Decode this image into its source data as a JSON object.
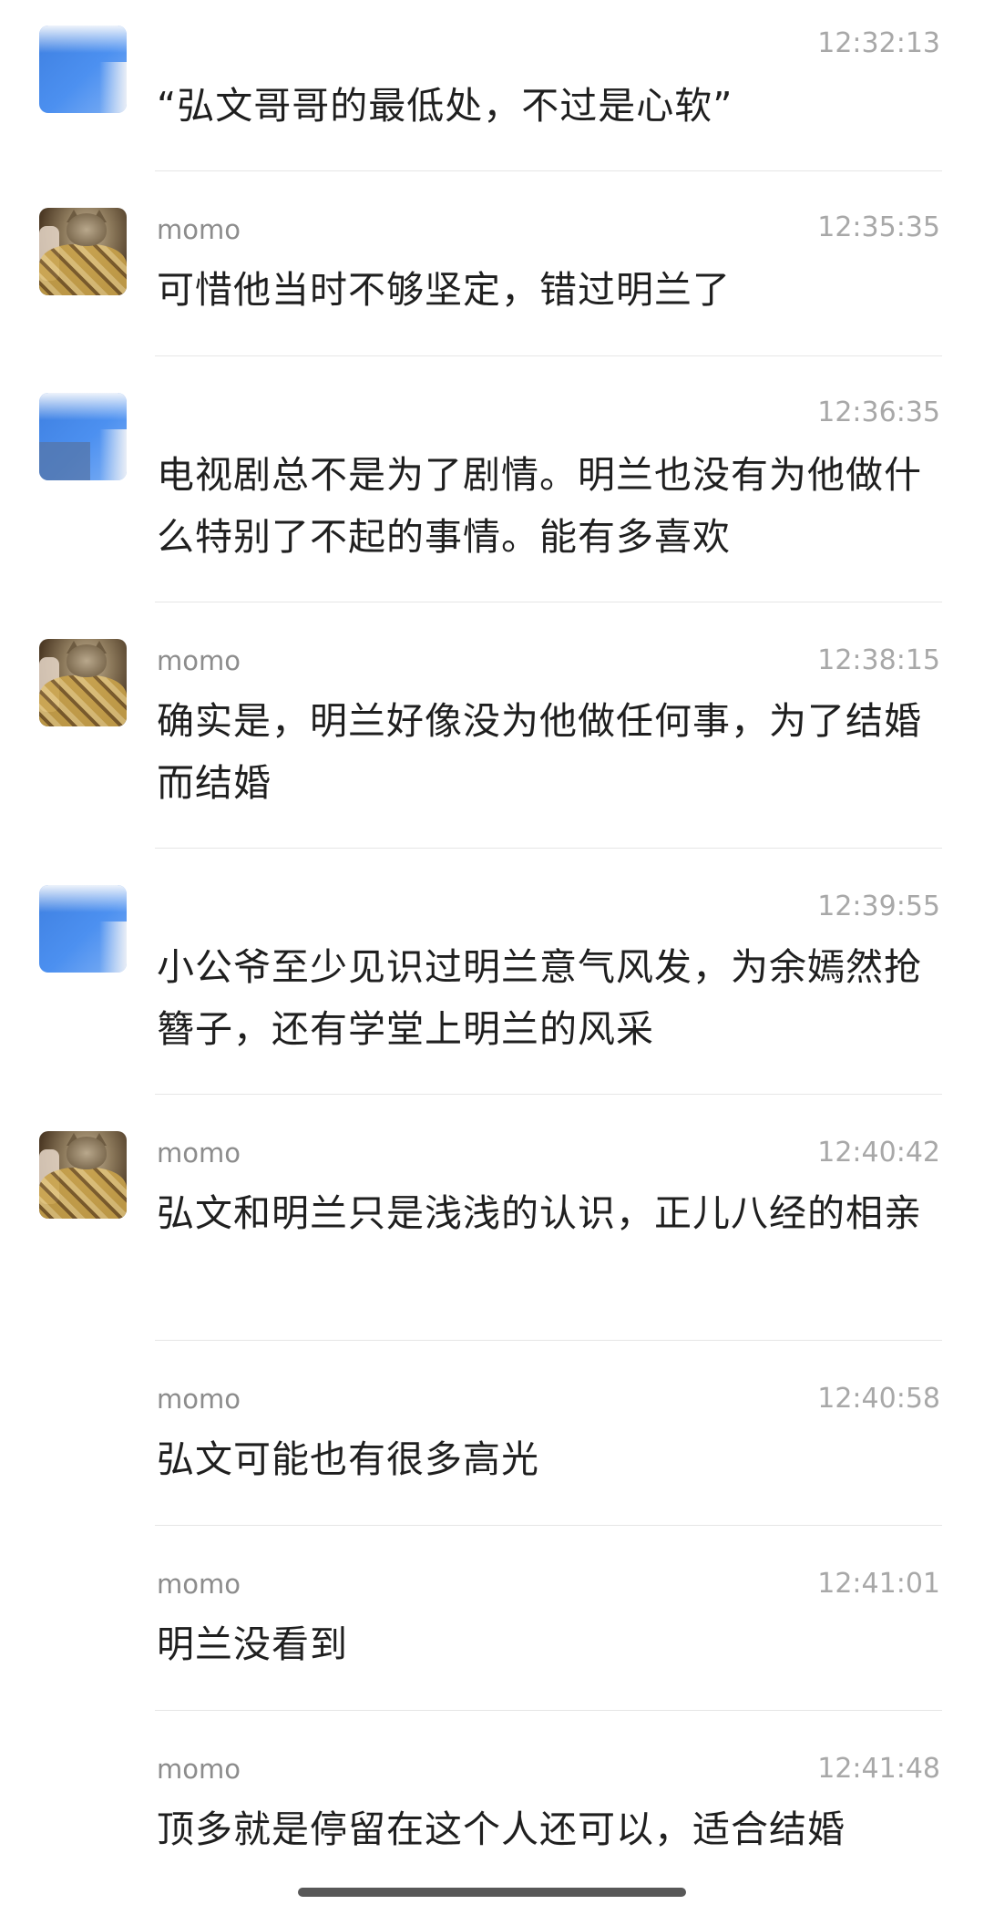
{
  "messages": [
    {
      "sender": "",
      "time": "12:32:13",
      "text": "“弘文哥哥的最低处，不过是心软”",
      "avatar": "blurred-avatar"
    },
    {
      "sender": "momo",
      "time": "12:35:35",
      "text": "可惜他当时不够坚定，错过明兰了",
      "avatar": "cat-avatar"
    },
    {
      "sender": "",
      "time": "12:36:35",
      "text": "电视剧总不是为了剧情。明兰也没有为他做什么特别了不起的事情。能有多喜欢",
      "avatar": "blurred-avatar"
    },
    {
      "sender": "momo",
      "time": "12:38:15",
      "text": "确实是，明兰好像没为他做任何事，为了结婚而结婚",
      "avatar": "cat-avatar"
    },
    {
      "sender": "",
      "time": "12:39:55",
      "text": "小公爷至少见识过明兰意气风发，为余嫣然抢簪子，还有学堂上明兰的风采",
      "avatar": "blurred-avatar"
    },
    {
      "sender": "momo",
      "time": "12:40:42",
      "text": "弘文和明兰只是浅浅的认识，正儿八经的相亲",
      "avatar": "cat-avatar"
    },
    {
      "sender": "momo",
      "time": "12:40:58",
      "text": "弘文可能也有很多高光",
      "avatar": ""
    },
    {
      "sender": "momo",
      "time": "12:41:01",
      "text": "明兰没看到",
      "avatar": ""
    },
    {
      "sender": "momo",
      "time": "12:41:48",
      "text": "顶多就是停留在这个人还可以，适合结婚",
      "avatar": ""
    }
  ]
}
